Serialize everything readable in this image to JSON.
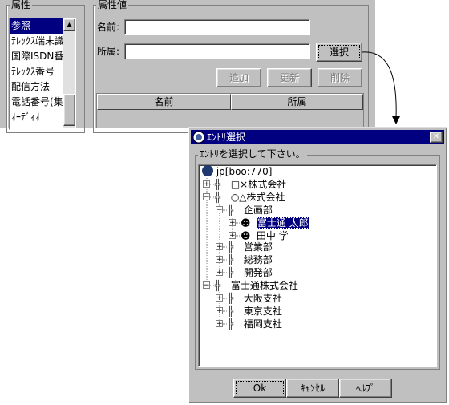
{
  "bg": {
    "attr_group_label": "属性",
    "value_group_label": "属性値",
    "attr_list": [
      "参照",
      "ﾃﾚｯｸｽ端末識",
      "国際ISDN番",
      "ﾃﾚｯｸｽ番号",
      "配信方法",
      "電話番号(集",
      "ｵｰﾃﾞｨｵ"
    ],
    "name_label": "名前:",
    "name_value": "",
    "affil_label": "所属:",
    "affil_value": "",
    "select_button": "選択",
    "add_button": "追加",
    "update_button": "更新",
    "delete_button": "削除",
    "col_name": "名前",
    "col_affil": "所属"
  },
  "dialog": {
    "title": "ｴﾝﾄﾘ選択",
    "close_glyph": "✕",
    "prompt": "ｴﾝﾄﾘを選択して下さい。",
    "tree": {
      "root": "jp[boo:770]",
      "n1": "□×株式会社",
      "n2": "○△株式会社",
      "n2a": "企画部",
      "n2a1": "富士通 太郎",
      "n2a2": "田中 学",
      "n2b": "営業部",
      "n2c": "総務部",
      "n2d": "開発部",
      "n3": "富士通株式会社",
      "n3a": "大阪支社",
      "n3b": "東京支社",
      "n3c": "福岡支社"
    },
    "ok_button": "Ok",
    "cancel_button": "ｷｬﾝｾﾙ",
    "help_button": "ﾍﾙﾌﾟ"
  }
}
